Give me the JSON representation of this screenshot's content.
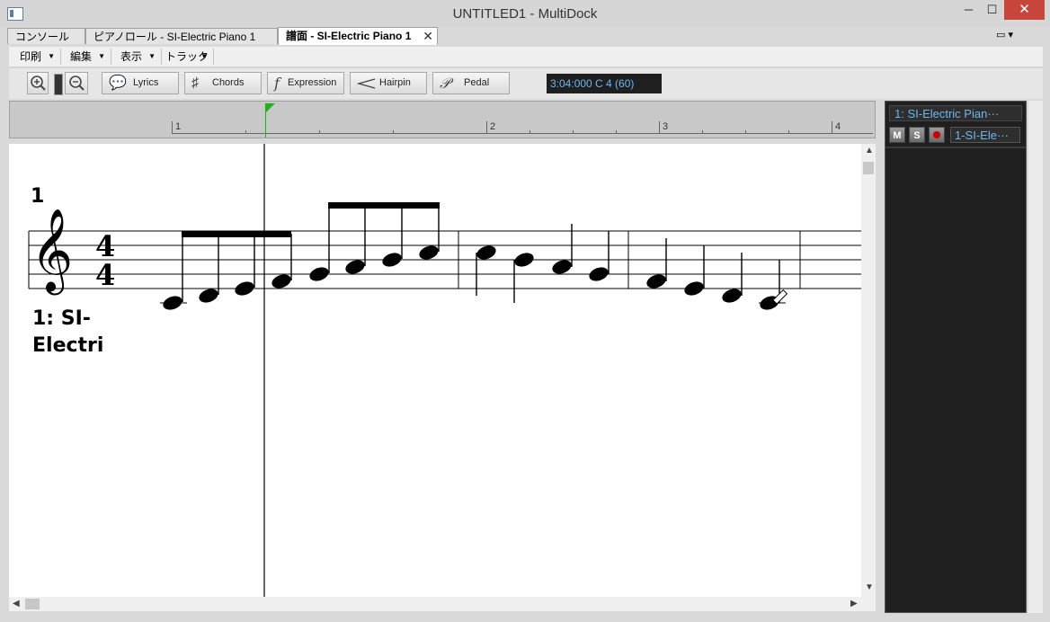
{
  "window": {
    "title": "UNTITLED1 - MultiDock",
    "minimize": "─",
    "maximize": "☐",
    "close": "✕"
  },
  "tabs": [
    {
      "label": "コンソール"
    },
    {
      "label": "ピアノロール - SI-Electric Piano 1"
    },
    {
      "label": "譜面  - SI-Electric  Piano 1"
    }
  ],
  "tab_close": "✕",
  "tab_menu": "▭ ▾",
  "menu": [
    {
      "label": "印刷"
    },
    {
      "label": "編集"
    },
    {
      "label": "表示"
    },
    {
      "label": "トラック"
    }
  ],
  "menu_arrow": "▼",
  "toolbar": {
    "lyrics": "Lyrics",
    "chords": "Chords",
    "expression": "Expression",
    "hairpin": "Hairpin",
    "pedal": "Pedal",
    "time_display": "3:04:000  C 4 (60)"
  },
  "ruler": {
    "bars": [
      "1",
      "2",
      "3",
      "4"
    ]
  },
  "score": {
    "measure_number": "1",
    "time_signature": {
      "top": "4",
      "bottom": "4"
    },
    "track_label": "1: SI-Electri"
  },
  "right_panel": {
    "track_name": "1: SI-Electric Pian···",
    "mute": "M",
    "solo": "S",
    "output": "1-SI-Ele···"
  },
  "colors": {
    "time_text": "#6ab8f0",
    "playhead_marker": "#1db31d",
    "close_button": "#c7453b",
    "record": "#cc0000"
  }
}
